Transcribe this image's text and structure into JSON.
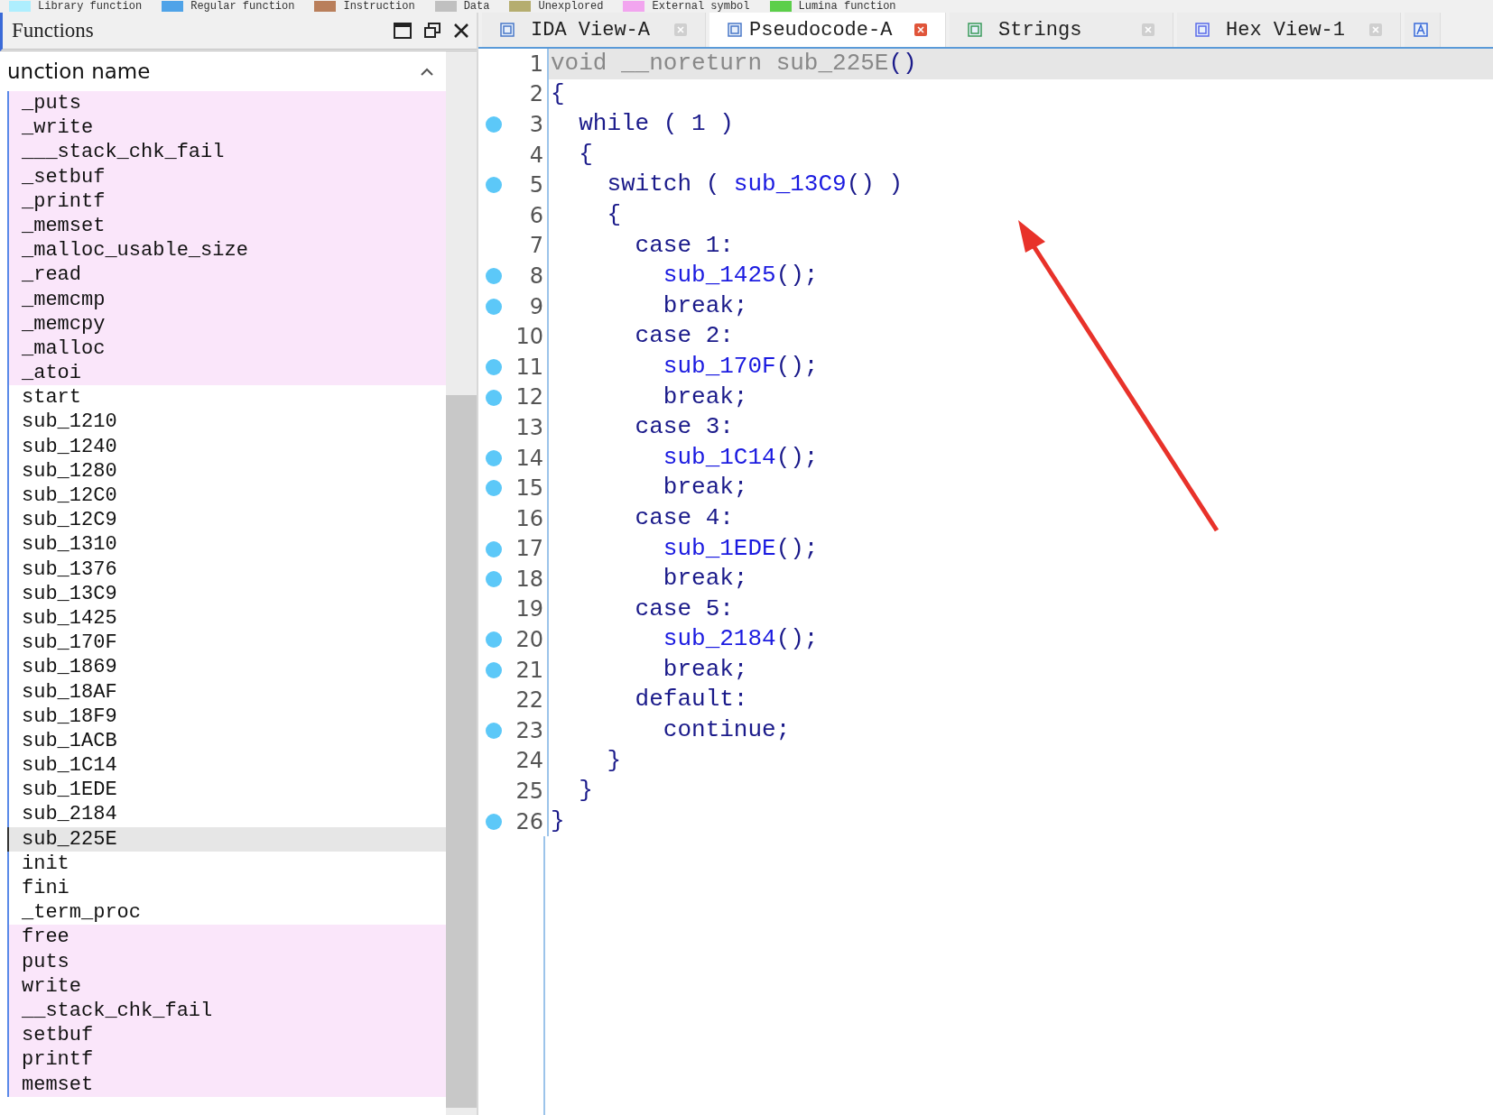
{
  "legend": [
    {
      "label": "Library function",
      "color": "#aeeefe"
    },
    {
      "label": "Regular function",
      "color": "#4fa3e8"
    },
    {
      "label": "Instruction",
      "color": "#b97f5b"
    },
    {
      "label": "Data",
      "color": "#c0c0c0"
    },
    {
      "label": "Unexplored",
      "color": "#b5ad6f"
    },
    {
      "label": "External symbol",
      "color": "#f2a5ef"
    },
    {
      "label": "Lumina function",
      "color": "#5ccf4a"
    }
  ],
  "functions_panel": {
    "title": "Functions",
    "column": "unction name",
    "rows": [
      {
        "name": "_puts",
        "kind": "external",
        "selected": false
      },
      {
        "name": "_write",
        "kind": "external",
        "selected": false
      },
      {
        "name": "___stack_chk_fail",
        "kind": "external",
        "selected": false
      },
      {
        "name": "_setbuf",
        "kind": "external",
        "selected": false
      },
      {
        "name": "_printf",
        "kind": "external",
        "selected": false
      },
      {
        "name": "_memset",
        "kind": "external",
        "selected": false
      },
      {
        "name": "_malloc_usable_size",
        "kind": "external",
        "selected": false
      },
      {
        "name": "_read",
        "kind": "external",
        "selected": false
      },
      {
        "name": "_memcmp",
        "kind": "external",
        "selected": false
      },
      {
        "name": "_memcpy",
        "kind": "external",
        "selected": false
      },
      {
        "name": "_malloc",
        "kind": "external",
        "selected": false
      },
      {
        "name": "_atoi",
        "kind": "external",
        "selected": false
      },
      {
        "name": "start",
        "kind": "regular",
        "selected": false
      },
      {
        "name": "sub_1210",
        "kind": "regular",
        "selected": false
      },
      {
        "name": "sub_1240",
        "kind": "regular",
        "selected": false
      },
      {
        "name": "sub_1280",
        "kind": "regular",
        "selected": false
      },
      {
        "name": "sub_12C0",
        "kind": "regular",
        "selected": false
      },
      {
        "name": "sub_12C9",
        "kind": "regular",
        "selected": false
      },
      {
        "name": "sub_1310",
        "kind": "regular",
        "selected": false
      },
      {
        "name": "sub_1376",
        "kind": "regular",
        "selected": false
      },
      {
        "name": "sub_13C9",
        "kind": "regular",
        "selected": false
      },
      {
        "name": "sub_1425",
        "kind": "regular",
        "selected": false
      },
      {
        "name": "sub_170F",
        "kind": "regular",
        "selected": false
      },
      {
        "name": "sub_1869",
        "kind": "regular",
        "selected": false
      },
      {
        "name": "sub_18AF",
        "kind": "regular",
        "selected": false
      },
      {
        "name": "sub_18F9",
        "kind": "regular",
        "selected": false
      },
      {
        "name": "sub_1ACB",
        "kind": "regular",
        "selected": false
      },
      {
        "name": "sub_1C14",
        "kind": "regular",
        "selected": false
      },
      {
        "name": "sub_1EDE",
        "kind": "regular",
        "selected": false
      },
      {
        "name": "sub_2184",
        "kind": "regular",
        "selected": false
      },
      {
        "name": "sub_225E",
        "kind": "regular",
        "selected": true
      },
      {
        "name": "init",
        "kind": "regular",
        "selected": false
      },
      {
        "name": "fini",
        "kind": "regular",
        "selected": false
      },
      {
        "name": "_term_proc",
        "kind": "regular",
        "selected": false
      },
      {
        "name": "free",
        "kind": "external",
        "selected": false
      },
      {
        "name": "puts",
        "kind": "external",
        "selected": false
      },
      {
        "name": "write",
        "kind": "external",
        "selected": false
      },
      {
        "name": "__stack_chk_fail",
        "kind": "external",
        "selected": false
      },
      {
        "name": "setbuf",
        "kind": "external",
        "selected": false
      },
      {
        "name": "printf",
        "kind": "external",
        "selected": false
      },
      {
        "name": "memset",
        "kind": "external",
        "selected": false
      }
    ]
  },
  "tabs": [
    {
      "label": "IDA View-A",
      "selected": false
    },
    {
      "label": "Pseudocode-A",
      "selected": true
    },
    {
      "label": "Strings",
      "selected": false
    },
    {
      "label": "Hex View-1",
      "selected": false
    },
    {
      "selected": false
    }
  ],
  "code": [
    {
      "number": "1",
      "breakpoint": false,
      "current": true,
      "tokens": [
        {
          "text": "void __noreturn sub_225E",
          "kind": "dim"
        },
        {
          "text": "()",
          "kind": "plain"
        }
      ]
    },
    {
      "number": "2",
      "breakpoint": false,
      "current": false,
      "tokens": [
        {
          "text": "{",
          "kind": "plain"
        }
      ]
    },
    {
      "number": "3",
      "breakpoint": true,
      "current": false,
      "tokens": [
        {
          "text": "  while ( 1 )",
          "kind": "plain"
        }
      ]
    },
    {
      "number": "4",
      "breakpoint": false,
      "current": false,
      "tokens": [
        {
          "text": "  {",
          "kind": "plain"
        }
      ]
    },
    {
      "number": "5",
      "breakpoint": true,
      "current": false,
      "tokens": [
        {
          "text": "    switch ( ",
          "kind": "plain"
        },
        {
          "text": "sub_13C9",
          "kind": "func"
        },
        {
          "text": "() )",
          "kind": "plain"
        }
      ]
    },
    {
      "number": "6",
      "breakpoint": false,
      "current": false,
      "tokens": [
        {
          "text": "    {",
          "kind": "plain"
        }
      ]
    },
    {
      "number": "7",
      "breakpoint": false,
      "current": false,
      "tokens": [
        {
          "text": "      case 1:",
          "kind": "plain"
        }
      ]
    },
    {
      "number": "8",
      "breakpoint": true,
      "current": false,
      "tokens": [
        {
          "text": "        sub_1425",
          "kind": "func"
        },
        {
          "text": "();",
          "kind": "plain"
        }
      ]
    },
    {
      "number": "9",
      "breakpoint": true,
      "current": false,
      "tokens": [
        {
          "text": "        break;",
          "kind": "plain"
        }
      ]
    },
    {
      "number": "10",
      "breakpoint": false,
      "current": false,
      "tokens": [
        {
          "text": "      case 2:",
          "kind": "plain"
        }
      ]
    },
    {
      "number": "11",
      "breakpoint": true,
      "current": false,
      "tokens": [
        {
          "text": "        sub_170F",
          "kind": "func"
        },
        {
          "text": "();",
          "kind": "plain"
        }
      ]
    },
    {
      "number": "12",
      "breakpoint": true,
      "current": false,
      "tokens": [
        {
          "text": "        break;",
          "kind": "plain"
        }
      ]
    },
    {
      "number": "13",
      "breakpoint": false,
      "current": false,
      "tokens": [
        {
          "text": "      case 3:",
          "kind": "plain"
        }
      ]
    },
    {
      "number": "14",
      "breakpoint": true,
      "current": false,
      "tokens": [
        {
          "text": "        sub_1C14",
          "kind": "func"
        },
        {
          "text": "();",
          "kind": "plain"
        }
      ]
    },
    {
      "number": "15",
      "breakpoint": true,
      "current": false,
      "tokens": [
        {
          "text": "        break;",
          "kind": "plain"
        }
      ]
    },
    {
      "number": "16",
      "breakpoint": false,
      "current": false,
      "tokens": [
        {
          "text": "      case 4:",
          "kind": "plain"
        }
      ]
    },
    {
      "number": "17",
      "breakpoint": true,
      "current": false,
      "tokens": [
        {
          "text": "        sub_1EDE",
          "kind": "func"
        },
        {
          "text": "();",
          "kind": "plain"
        }
      ]
    },
    {
      "number": "18",
      "breakpoint": true,
      "current": false,
      "tokens": [
        {
          "text": "        break;",
          "kind": "plain"
        }
      ]
    },
    {
      "number": "19",
      "breakpoint": false,
      "current": false,
      "tokens": [
        {
          "text": "      case 5:",
          "kind": "plain"
        }
      ]
    },
    {
      "number": "20",
      "breakpoint": true,
      "current": false,
      "tokens": [
        {
          "text": "        sub_2184",
          "kind": "func"
        },
        {
          "text": "();",
          "kind": "plain"
        }
      ]
    },
    {
      "number": "21",
      "breakpoint": true,
      "current": false,
      "tokens": [
        {
          "text": "        break;",
          "kind": "plain"
        }
      ]
    },
    {
      "number": "22",
      "breakpoint": false,
      "current": false,
      "tokens": [
        {
          "text": "      default:",
          "kind": "plain"
        }
      ]
    },
    {
      "number": "23",
      "breakpoint": true,
      "current": false,
      "tokens": [
        {
          "text": "        continue;",
          "kind": "plain"
        }
      ]
    },
    {
      "number": "24",
      "breakpoint": false,
      "current": false,
      "tokens": [
        {
          "text": "    }",
          "kind": "plain"
        }
      ]
    },
    {
      "number": "25",
      "breakpoint": false,
      "current": false,
      "tokens": [
        {
          "text": "  }",
          "kind": "plain"
        }
      ]
    },
    {
      "number": "26",
      "breakpoint": true,
      "current": false,
      "tokens": [
        {
          "text": "}",
          "kind": "plain"
        }
      ]
    }
  ]
}
